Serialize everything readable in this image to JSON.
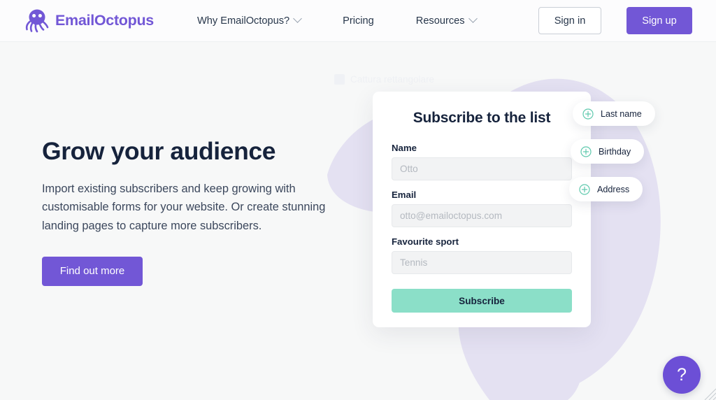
{
  "brand": {
    "name": "EmailOctopus",
    "logo_icon": "octopus-icon",
    "accent_color": "#7257d6"
  },
  "header": {
    "nav": [
      {
        "label": "Why EmailOctopus?",
        "has_dropdown": true
      },
      {
        "label": "Pricing",
        "has_dropdown": false
      },
      {
        "label": "Resources",
        "has_dropdown": true
      }
    ],
    "sign_in_label": "Sign in",
    "sign_up_label": "Sign up"
  },
  "hero": {
    "title": "Grow your audience",
    "subtitle": "Import existing subscribers and keep growing with customisable forms for your website. Or create stunning landing pages to capture more subscribers.",
    "cta_label": "Find out more"
  },
  "subscribe_card": {
    "title": "Subscribe to the list",
    "fields": [
      {
        "label": "Name",
        "placeholder": "Otto",
        "value": ""
      },
      {
        "label": "Email",
        "placeholder": "otto@emailoctopus.com",
        "value": ""
      },
      {
        "label": "Favourite sport",
        "placeholder": "Tennis",
        "value": ""
      }
    ],
    "submit_label": "Subscribe",
    "submit_color": "#8bdfc8"
  },
  "field_chips": [
    {
      "label": "Last name",
      "icon": "plus-circle-icon"
    },
    {
      "label": "Birthday",
      "icon": "plus-circle-icon"
    },
    {
      "label": "Address",
      "icon": "plus-circle-icon"
    }
  ],
  "overlay_ghost": {
    "label": "Cattura rettangolare",
    "icon": "snip-rectangle-icon"
  },
  "help_widget": {
    "label": "?",
    "color": "#6c4fd6"
  },
  "colors": {
    "page_background": "#f7f8f8",
    "header_background": "#fcfcfd",
    "blob": "#e4e1f2",
    "heading_text": "#16233c",
    "teal": "#5fc9ad"
  }
}
